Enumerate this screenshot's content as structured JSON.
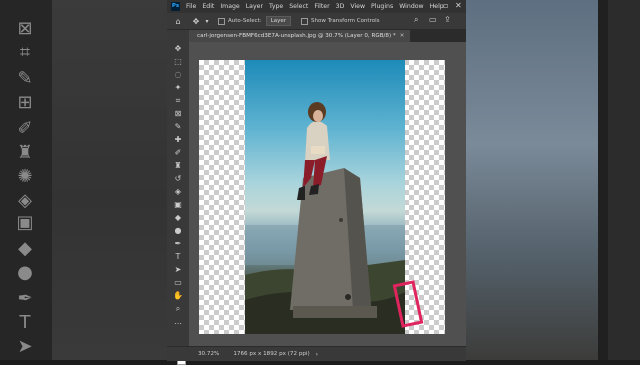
{
  "menubar": {
    "app_icon": "Ps",
    "items": [
      "File",
      "Edit",
      "Image",
      "Layer",
      "Type",
      "Select",
      "Filter",
      "3D",
      "View",
      "Plugins",
      "Window",
      "Help"
    ]
  },
  "options_bar": {
    "auto_select_label": "Auto-Select:",
    "auto_select_value": "Layer",
    "transform_controls_label": "Show Transform Controls"
  },
  "document": {
    "tab_title": "carl-jorgensen-FBMF6cd3E7A-unsplash.jpg @ 30.7% (Layer 0, RGB/8) *",
    "zoom": "30.72%",
    "info": "1766 px x 1892 px (72 ppi)"
  },
  "colors": {
    "accent": "#31a8ff",
    "annotation": "#e0245e",
    "panel": "#535353"
  },
  "icons": {
    "left_background": [
      "rectangle-tool-icon",
      "crop-icon",
      "eyedropper-icon",
      "frame-icon",
      "brush-icon",
      "clone-stamp-icon",
      "healing-icon",
      "eraser-icon",
      "gradient-icon",
      "blur-icon",
      "dodge-icon",
      "pen-icon",
      "type-icon",
      "path-select-icon"
    ],
    "window_controls": [
      "minimize-icon",
      "restore-icon",
      "close-icon"
    ]
  }
}
